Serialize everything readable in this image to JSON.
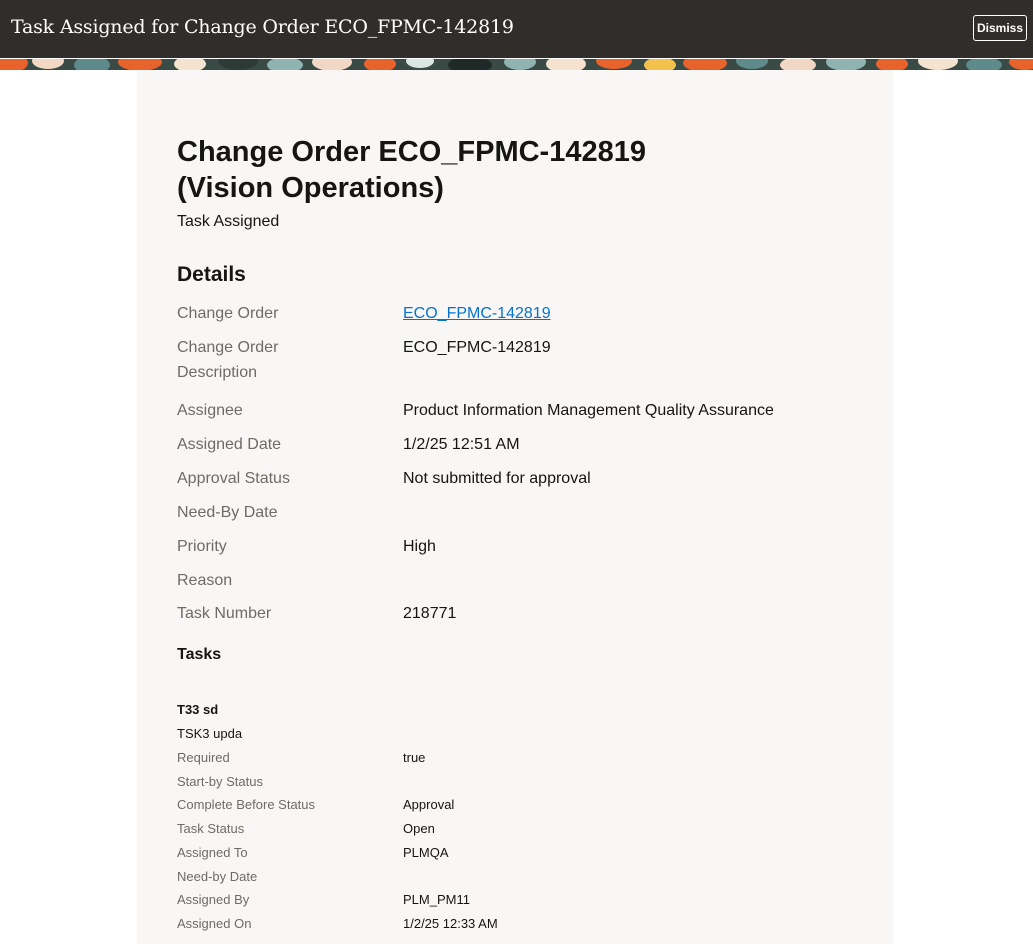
{
  "header": {
    "title": "Task Assigned for Change Order ECO_FPMC-142819",
    "dismiss_label": "Dismiss"
  },
  "main": {
    "title_line1": "Change Order ECO_FPMC-142819",
    "title_line2": "(Vision Operations)",
    "subtitle": "Task Assigned",
    "details_heading": "Details",
    "details": [
      {
        "label": "Change Order",
        "value": "ECO_FPMC-142819",
        "is_link": true
      },
      {
        "label_line1": "Change Order",
        "label_line2": "Description",
        "value": "ECO_FPMC-142819"
      },
      {
        "label": "Assignee",
        "value": "Product Information Management Quality Assurance"
      },
      {
        "label": "Assigned Date",
        "value": "1/2/25 12:51 AM"
      },
      {
        "label": "Approval Status",
        "value": "Not submitted for approval"
      },
      {
        "label": "Need-By Date",
        "value": ""
      },
      {
        "label": "Priority",
        "value": "High"
      },
      {
        "label": "Reason",
        "value": ""
      },
      {
        "label": "Task Number",
        "value": "218771"
      }
    ],
    "tasks_heading": "Tasks",
    "task": {
      "name": "T33 sd",
      "description": "TSK3 upda",
      "fields": [
        {
          "label": "Required",
          "value": "true"
        },
        {
          "label": "Start-by Status",
          "value": ""
        },
        {
          "label": "Complete Before Status",
          "value": "Approval"
        },
        {
          "label": "Task Status",
          "value": "Open"
        },
        {
          "label": "Assigned To",
          "value": "PLMQA"
        },
        {
          "label": "Need-by Date",
          "value": ""
        },
        {
          "label": "Assigned By",
          "value": "PLM_PM11"
        },
        {
          "label": "Assigned On",
          "value": "1/2/25 12:33 AM"
        }
      ]
    }
  },
  "colors": {
    "header_bg": "#312d2a",
    "panel_bg": "#f8f7f5",
    "link": "#0572ce",
    "label": "#6f6b66"
  }
}
